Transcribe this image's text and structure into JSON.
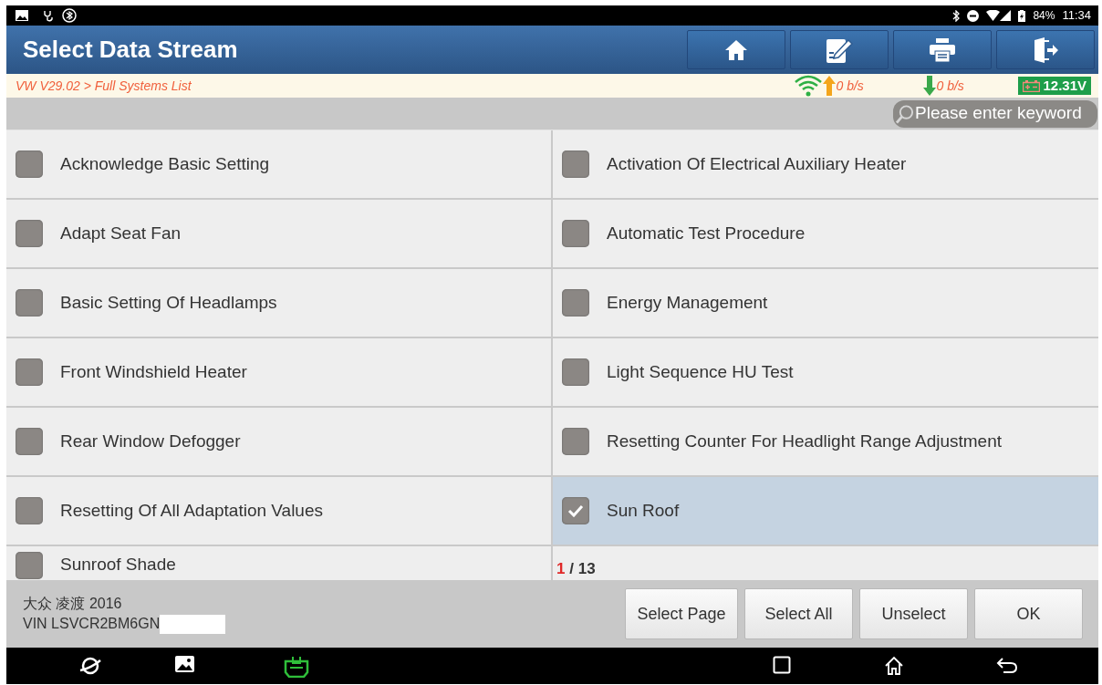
{
  "status_bar": {
    "battery": "84%",
    "time": "11:34"
  },
  "header": {
    "title": "Select Data Stream"
  },
  "breadcrumb": "VW V29.02 > Full Systems List",
  "connection": {
    "upload_rate": "0 b/s",
    "download_rate": "0 b/s",
    "voltage": "12.31V"
  },
  "search": {
    "placeholder": "Please enter keyword"
  },
  "items": [
    {
      "label": "Acknowledge Basic Setting",
      "checked": false,
      "selected": false
    },
    {
      "label": "Activation Of Electrical Auxiliary Heater",
      "checked": false,
      "selected": false
    },
    {
      "label": "Adapt Seat Fan",
      "checked": false,
      "selected": false
    },
    {
      "label": "Automatic Test Procedure",
      "checked": false,
      "selected": false
    },
    {
      "label": "Basic Setting Of Headlamps",
      "checked": false,
      "selected": false
    },
    {
      "label": "Energy Management",
      "checked": false,
      "selected": false
    },
    {
      "label": "Front Windshield Heater",
      "checked": false,
      "selected": false
    },
    {
      "label": "Light Sequence HU Test",
      "checked": false,
      "selected": false
    },
    {
      "label": "Rear Window Defogger",
      "checked": false,
      "selected": false
    },
    {
      "label": "Resetting Counter For Headlight Range Adjustment",
      "checked": false,
      "selected": false
    },
    {
      "label": "Resetting Of All Adaptation Values",
      "checked": false,
      "selected": false
    },
    {
      "label": "Sun Roof",
      "checked": true,
      "selected": true
    },
    {
      "label": "Sunroof Shade",
      "checked": false,
      "selected": false
    }
  ],
  "pager": {
    "current": "1",
    "separator": "/",
    "total": "13"
  },
  "footer": {
    "vehicle": "大众 凌渡 2016",
    "vin": "VIN LSVCR2BM6GN"
  },
  "buttons": [
    "Select Page",
    "Select All",
    "Unselect",
    "OK"
  ]
}
